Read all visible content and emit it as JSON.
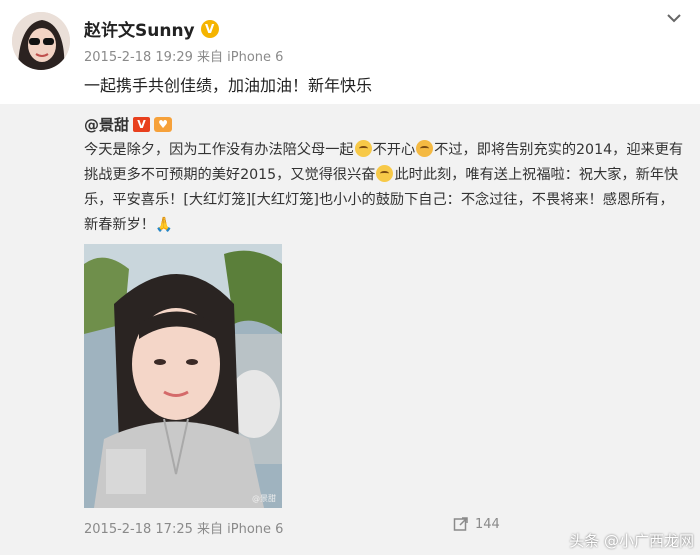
{
  "post": {
    "username": "赵许文Sunny",
    "verified_glyph": "V",
    "timestamp": "2015-2-18 19:29",
    "source": "来自 iPhone 6",
    "text": "一起携手共创佳绩，加油加油！新年快乐"
  },
  "repost": {
    "username": "@景甜",
    "verified_glyph": "V",
    "text_parts": {
      "p1": "今天是除夕，因为工作没有办法陪父母一起",
      "p2": "不开心",
      "p3": "不过，即将告别充实的2014，迎来更有挑战更多不可预期的美好2015，又觉得很兴奋",
      "p4": "此时此刻，唯有送上祝福啦：祝大家，新年快乐，平安喜乐！[大红灯笼][大红灯笼]也小小的鼓励下自己：不念过往，不畏将来！感恩所有，新春新岁！",
      "p5": "🙏"
    },
    "timestamp": "2015-2-18 17:25",
    "source": "来自 iPhone 6",
    "share_count": "144",
    "photo_caption": "@景甜"
  },
  "watermark": "头条 @小广西龙网",
  "colors": {
    "repost_bg": "#f2f2f2",
    "meta_gray": "#8a8a8a",
    "verified_gold": "#f5b400",
    "verified_red": "#e8401e"
  },
  "icons": [
    "chevron-down-icon",
    "share-icon",
    "sad-emoji-icon",
    "crying-emoji-icon",
    "smile-emoji-icon",
    "pray-icon"
  ]
}
